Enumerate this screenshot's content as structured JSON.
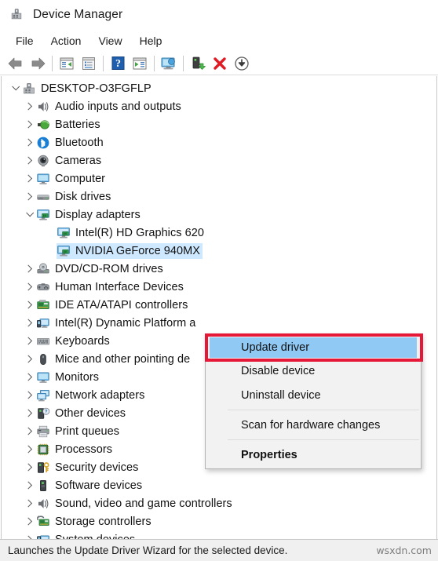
{
  "window": {
    "title": "Device Manager",
    "title_icon": "device-manager-icon"
  },
  "menubar": {
    "items": [
      {
        "label": "File",
        "name": "menu-file"
      },
      {
        "label": "Action",
        "name": "menu-action"
      },
      {
        "label": "View",
        "name": "menu-view"
      },
      {
        "label": "Help",
        "name": "menu-help"
      }
    ]
  },
  "toolbar": {
    "buttons": [
      {
        "icon": "back-arrow-icon",
        "name": "toolbar-back"
      },
      {
        "icon": "forward-arrow-icon",
        "name": "toolbar-forward"
      },
      {
        "icon": "show-hide-console-tree-icon",
        "name": "toolbar-console-tree"
      },
      {
        "icon": "properties-icon",
        "name": "toolbar-properties"
      },
      {
        "icon": "help-icon",
        "name": "toolbar-help"
      },
      {
        "icon": "show-hide-action-pane-icon",
        "name": "toolbar-action-pane"
      },
      {
        "icon": "scan-hardware-changes-icon",
        "name": "toolbar-scan-hardware"
      },
      {
        "icon": "update-driver-icon",
        "name": "toolbar-update-driver"
      },
      {
        "icon": "uninstall-device-icon",
        "name": "toolbar-uninstall-device"
      },
      {
        "icon": "disable-device-icon",
        "name": "toolbar-disable-device"
      }
    ]
  },
  "tree": {
    "nodes": [
      {
        "label": "DESKTOP-O3FGFLP",
        "depth": 0,
        "state": "expanded",
        "icon": "computer-root-icon",
        "selected": false
      },
      {
        "label": "Audio inputs and outputs",
        "depth": 1,
        "state": "collapsed",
        "icon": "speaker-icon",
        "selected": false
      },
      {
        "label": "Batteries",
        "depth": 1,
        "state": "collapsed",
        "icon": "battery-icon",
        "selected": false
      },
      {
        "label": "Bluetooth",
        "depth": 1,
        "state": "collapsed",
        "icon": "bluetooth-icon",
        "selected": false
      },
      {
        "label": "Cameras",
        "depth": 1,
        "state": "collapsed",
        "icon": "camera-icon",
        "selected": false
      },
      {
        "label": "Computer",
        "depth": 1,
        "state": "collapsed",
        "icon": "monitor-icon",
        "selected": false
      },
      {
        "label": "Disk drives",
        "depth": 1,
        "state": "collapsed",
        "icon": "disk-drive-icon",
        "selected": false
      },
      {
        "label": "Display adapters",
        "depth": 1,
        "state": "expanded",
        "icon": "display-adapter-icon",
        "selected": false
      },
      {
        "label": "Intel(R) HD Graphics 620",
        "depth": 2,
        "state": "leaf",
        "icon": "display-adapter-icon",
        "selected": false
      },
      {
        "label": "NVIDIA GeForce 940MX",
        "depth": 2,
        "state": "leaf",
        "icon": "display-adapter-icon",
        "selected": true
      },
      {
        "label": "DVD/CD-ROM drives",
        "depth": 1,
        "state": "collapsed",
        "icon": "optical-drive-icon",
        "selected": false
      },
      {
        "label": "Human Interface Devices",
        "depth": 1,
        "state": "collapsed",
        "icon": "hid-icon",
        "selected": false
      },
      {
        "label": "IDE ATA/ATAPI controllers",
        "depth": 1,
        "state": "collapsed",
        "icon": "ide-controller-icon",
        "selected": false
      },
      {
        "label": "Intel(R) Dynamic Platform a",
        "depth": 1,
        "state": "collapsed",
        "icon": "platform-icon",
        "selected": false
      },
      {
        "label": "Keyboards",
        "depth": 1,
        "state": "collapsed",
        "icon": "keyboard-icon",
        "selected": false
      },
      {
        "label": "Mice and other pointing de",
        "depth": 1,
        "state": "collapsed",
        "icon": "mouse-icon",
        "selected": false
      },
      {
        "label": "Monitors",
        "depth": 1,
        "state": "collapsed",
        "icon": "monitor-icon",
        "selected": false
      },
      {
        "label": "Network adapters",
        "depth": 1,
        "state": "collapsed",
        "icon": "network-adapter-icon",
        "selected": false
      },
      {
        "label": "Other devices",
        "depth": 1,
        "state": "collapsed",
        "icon": "unknown-device-icon",
        "selected": false
      },
      {
        "label": "Print queues",
        "depth": 1,
        "state": "collapsed",
        "icon": "printer-icon",
        "selected": false
      },
      {
        "label": "Processors",
        "depth": 1,
        "state": "collapsed",
        "icon": "processor-icon",
        "selected": false
      },
      {
        "label": "Security devices",
        "depth": 1,
        "state": "collapsed",
        "icon": "security-device-icon",
        "selected": false
      },
      {
        "label": "Software devices",
        "depth": 1,
        "state": "collapsed",
        "icon": "software-device-icon",
        "selected": false
      },
      {
        "label": "Sound, video and game controllers",
        "depth": 1,
        "state": "collapsed",
        "icon": "speaker-icon",
        "selected": false
      },
      {
        "label": "Storage controllers",
        "depth": 1,
        "state": "collapsed",
        "icon": "storage-controller-icon",
        "selected": false
      },
      {
        "label": "System devices",
        "depth": 1,
        "state": "collapsed",
        "icon": "system-device-icon",
        "selected": false
      }
    ]
  },
  "context_menu": {
    "items": [
      {
        "label": "Update driver",
        "highlighted": true,
        "bold": false,
        "separator_before": false
      },
      {
        "label": "Disable device",
        "highlighted": false,
        "bold": false,
        "separator_before": false
      },
      {
        "label": "Uninstall device",
        "highlighted": false,
        "bold": false,
        "separator_before": false
      },
      {
        "label": "Scan for hardware changes",
        "highlighted": false,
        "bold": false,
        "separator_before": true
      },
      {
        "label": "Properties",
        "highlighted": false,
        "bold": true,
        "separator_before": true
      }
    ]
  },
  "statusbar": {
    "text": "Launches the Update Driver Wizard for the selected device.",
    "watermark": "wsxdn.com"
  },
  "colors": {
    "selection_blue": "#cde8ff",
    "menu_highlight_blue": "#8fc9f4",
    "annotation_red": "#e51937",
    "menu_bg": "#f2f2f2",
    "status_bg": "#f0f0f0"
  }
}
